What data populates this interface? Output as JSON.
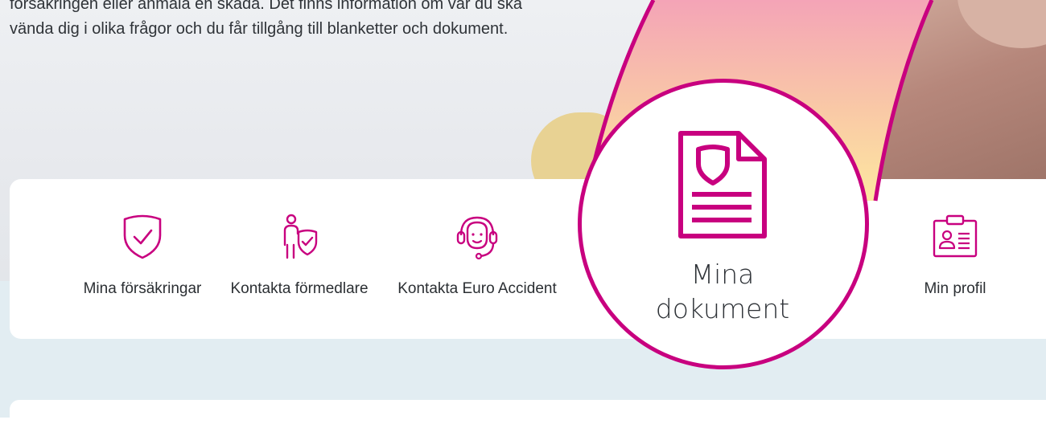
{
  "hero": {
    "text": "försäkringen eller anmäla en skada. Det finns information om var du ska vända dig i olika frågor och du får tillgång till blanketter och dokument."
  },
  "nav": {
    "items": [
      {
        "label": "Mina försäkringar",
        "icon": "shield-check-icon"
      },
      {
        "label": "Kontakta förmedlare",
        "icon": "person-shield-icon"
      },
      {
        "label": "Kontakta Euro Accident",
        "icon": "headset-support-icon"
      },
      {
        "label": "Mina dokument",
        "icon": "document-shield-icon",
        "highlighted": true
      },
      {
        "label": "Min profil",
        "icon": "id-card-icon"
      }
    ]
  },
  "spotlight": {
    "line1": "Mina",
    "line2": "dokument"
  },
  "colors": {
    "accent": "#c8007f",
    "section_bg": "#e2edf2",
    "text": "#2b2f33"
  }
}
